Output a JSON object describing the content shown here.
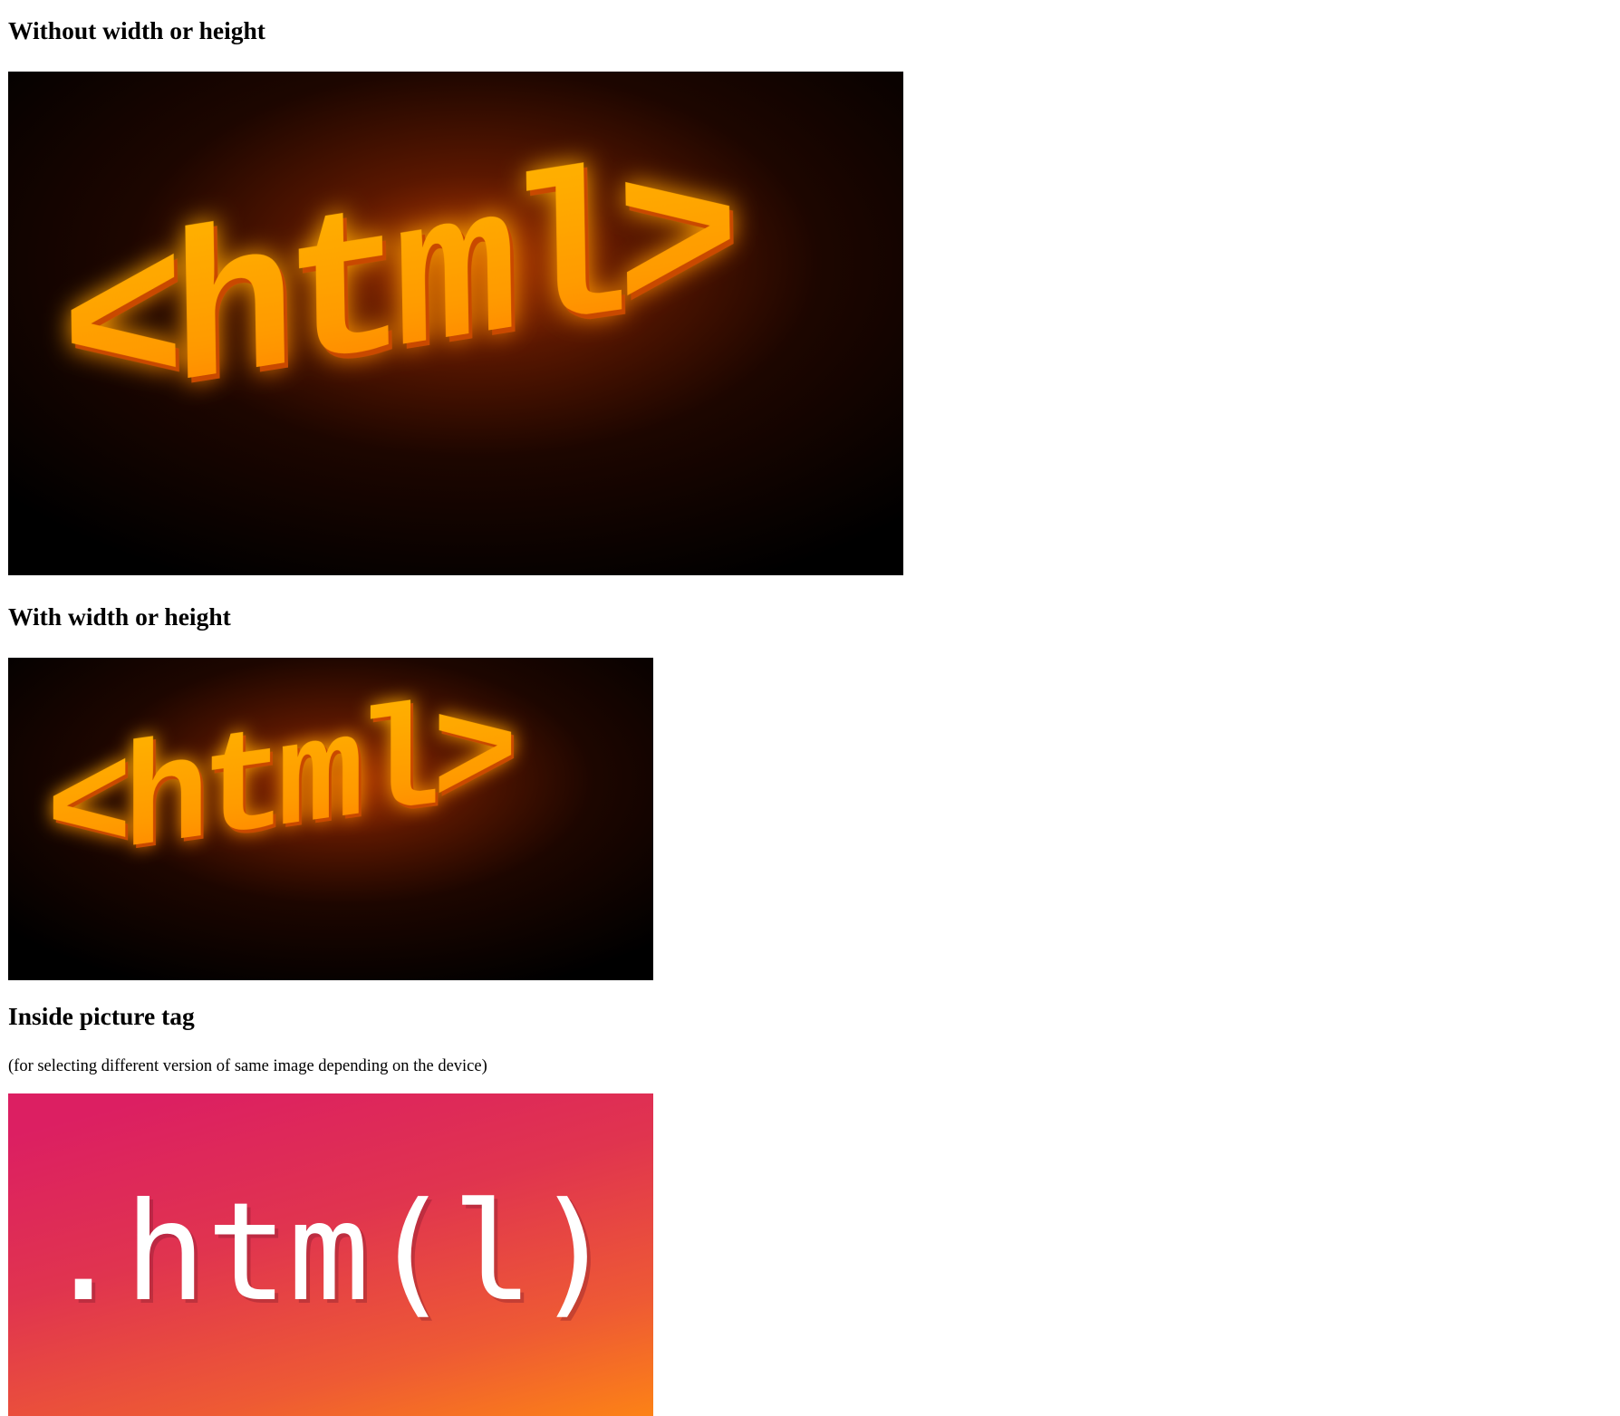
{
  "sections": [
    {
      "heading": "Without width or height",
      "image": {
        "text": "<html>",
        "style": "glowing-orange-3d-letters-on-black"
      }
    },
    {
      "heading": "With width or height",
      "image": {
        "text": "<html>",
        "style": "glowing-orange-3d-letters-on-black"
      }
    },
    {
      "heading": "Inside picture tag",
      "caption": "(for selecting different version of same image depending on the device)",
      "image": {
        "text": ".htm(l)",
        "style": "white-monospace-on-pink-orange-gradient"
      }
    }
  ],
  "colors": {
    "glow_orange": "#ff9a00",
    "glow_deep": "#ff5a00",
    "dark_bg": "#000000",
    "gradient_pink": "#dc1f62",
    "gradient_orange": "#ff8a10"
  }
}
